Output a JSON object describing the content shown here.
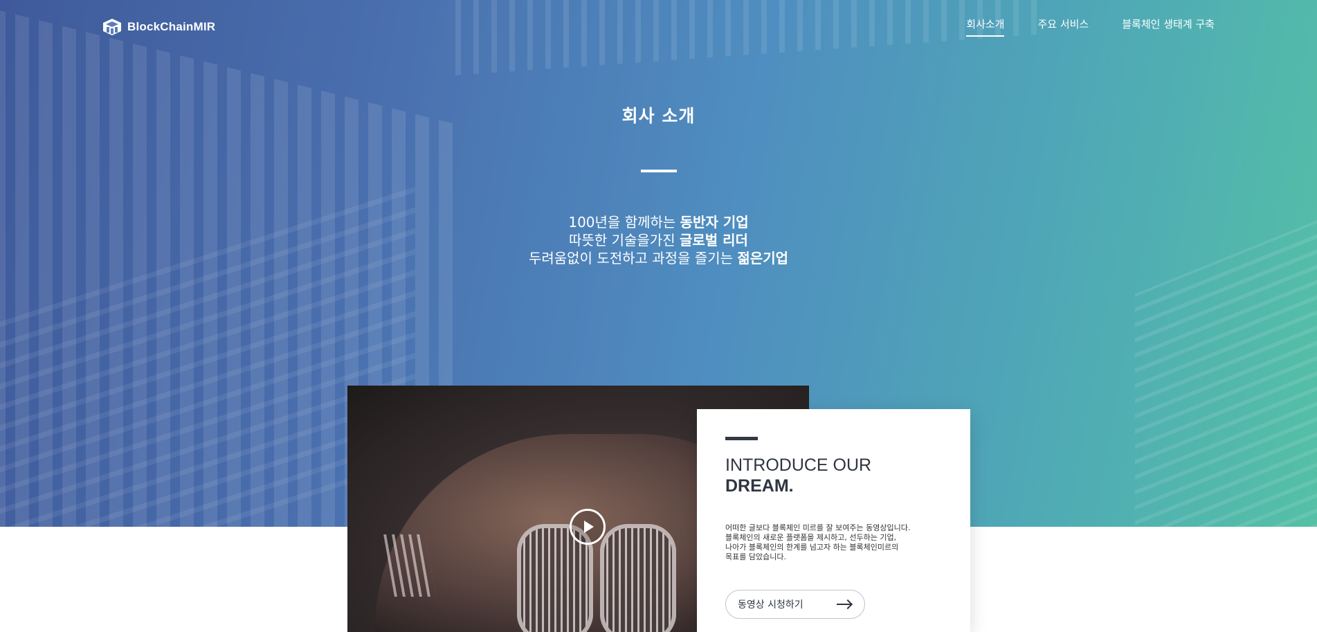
{
  "brand": {
    "logo_text": "BlockChainMIR",
    "logo_icon": "cube-icon"
  },
  "nav": {
    "items": [
      {
        "label": "회사소개",
        "active": true
      },
      {
        "label": "주요 서비스",
        "active": false
      },
      {
        "label": "블록체인 생태계 구축",
        "active": false
      }
    ]
  },
  "hero": {
    "title": "회사 소개",
    "lines": [
      {
        "normal": "100년을 함께하는",
        "bold": "동반자 기업"
      },
      {
        "normal": "따뜻한 기술을가진",
        "bold": "글로벌 리더"
      },
      {
        "normal": "두려움없이 도전하고 과정을 즐기는",
        "bold": "젊은기업"
      }
    ]
  },
  "video": {
    "play_icon": "play-icon"
  },
  "card": {
    "heading_line1": "INTRODUCE OUR",
    "heading_line2": "DREAM.",
    "desc_lines": [
      "어떠한 글보다 블록체인 미르를 잘 보여주는 동영상입니다.",
      "블록체인의 새로운 플랫폼을 제시하고, 선두하는 기업,",
      "나아가 블록체인의 한계를 넘고자 하는 블록체인미르의",
      "목표를 담았습니다."
    ],
    "button_label": "동영상 시청하기",
    "button_icon": "arrow-right-icon"
  },
  "colors": {
    "hero_gradient_start": "#3f5a9a",
    "hero_gradient_end": "#55c0a6",
    "card_text": "#2f3540"
  }
}
